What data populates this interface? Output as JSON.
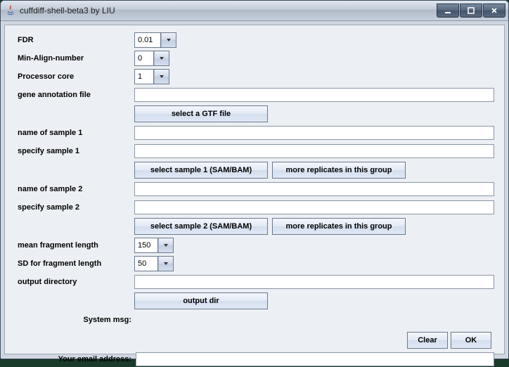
{
  "window": {
    "title": "cuffdiff-shell-beta3 by LIU"
  },
  "labels": {
    "fdr": "FDR",
    "min_align": "Min-Align-number",
    "proc_core": "Processor core",
    "gene_ann": "gene annotation file",
    "name_s1": "name of sample 1",
    "spec_s1": "specify sample 1",
    "name_s2": "name of sample 2",
    "spec_s2": "specify sample 2",
    "mean_frag": "mean fragment length",
    "sd_frag": "SD for fragment length",
    "out_dir": "output directory",
    "sysmsg": "System msg:",
    "email": "Your email address:"
  },
  "values": {
    "fdr": "0.01",
    "min_align": "0",
    "proc_core": "1",
    "gene_ann": "",
    "name_s1": "",
    "spec_s1": "",
    "name_s2": "",
    "spec_s2": "",
    "mean_frag": "150",
    "sd_frag": "50",
    "out_dir": "",
    "email": ""
  },
  "buttons": {
    "select_gtf": "select a GTF file",
    "select_s1": "select sample 1 (SAM/BAM)",
    "more_rep1": "more replicates in this group",
    "select_s2": "select sample 2 (SAM/BAM)",
    "more_rep2": "more replicates in this group",
    "output_dir": "output dir",
    "clear": "Clear",
    "ok": "OK"
  }
}
